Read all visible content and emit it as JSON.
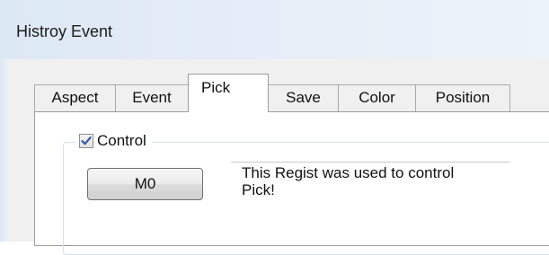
{
  "window": {
    "title": "Histroy Event"
  },
  "tabs": [
    {
      "label": "Aspect",
      "active": false
    },
    {
      "label": "Event",
      "active": false
    },
    {
      "label": "Pick",
      "active": true
    },
    {
      "label": "Save",
      "active": false
    },
    {
      "label": "Color",
      "active": false
    },
    {
      "label": "Position",
      "active": false
    }
  ],
  "pick_page": {
    "control_checkbox": {
      "label": "Control",
      "checked": true
    },
    "register_button": {
      "label": "M0"
    },
    "description": {
      "text": "This Regist was used to control\nPick!"
    }
  },
  "colors": {
    "titlebar": "#e3ecf6",
    "dialog_background": "#f0f0f0",
    "tab_page_background": "#ffffff",
    "checkmark": "#3a57a6"
  }
}
